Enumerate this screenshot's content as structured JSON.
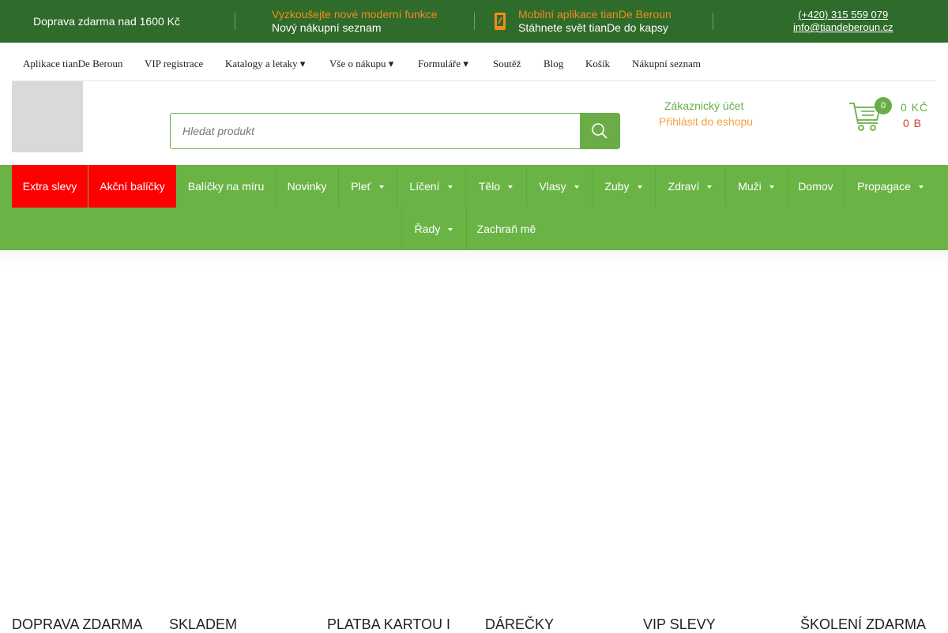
{
  "topbar": {
    "shipping": {
      "icon": "truck-icon",
      "text": "Doprava zdarma nad 1600 Kč"
    },
    "features": {
      "icon": "star-icon",
      "title": "Vyzkoušejte nové moderní funkce",
      "subtitle": "Nový nákupní seznam"
    },
    "app": {
      "icon": "mobile-phone-icon",
      "title": "Mobilní aplikace tianDe Beroun",
      "subtitle": "Stáhnete svět tianDe do kapsy"
    },
    "contact": {
      "icon": "envelope-icon",
      "phone": "(+420) 315 559 079",
      "email": "info@tiandeberoun.cz"
    },
    "colors": {
      "background": "#2f6b2a",
      "accent": "#f28c1e"
    }
  },
  "subnav": {
    "items": [
      "Aplikace tianDe Beroun",
      "VIP registrace",
      "Katalogy a letaky ▾",
      "Vše o nákupu ▾",
      "Formuláře ▾",
      "Soutěž",
      "Blog",
      "Košík",
      "Nákupní seznam"
    ]
  },
  "header": {
    "search": {
      "placeholder": "Hledat produkt",
      "icon": "search-icon"
    },
    "account": {
      "title": "Zákaznický účet",
      "login_icon": "user-icon",
      "login": "Přihlásit do eshopu"
    },
    "cart": {
      "icon": "cart-icon",
      "count": "0",
      "price": "0 KČ",
      "points": "0 B"
    },
    "colors": {
      "primary": "#6aad47",
      "login": "#f2a03c",
      "points": "#d23b2b"
    }
  },
  "mainmenu": {
    "items": [
      "Extra slevy",
      "Akční balíčky",
      "Balíčky na míru",
      "Novinky",
      "Pleť",
      "Líčení",
      "Tělo",
      "Vlasy",
      "Zuby",
      "Zdraví",
      "Muži",
      "Domov",
      "Propagace",
      "Řady",
      "Zachraň mě"
    ],
    "colors": {
      "background": "#6ab445",
      "highlight": "#ff0000"
    }
  },
  "features": [
    {
      "icon": "truck-icon",
      "label": "DOPRAVA ZDARMA"
    },
    {
      "icon": "box-icon",
      "label": "SKLADEM"
    },
    {
      "icon": "credit-card-icon",
      "label": "PLATBA KARTOU I"
    },
    {
      "icon": "gift-icon",
      "label": "DÁREČKY"
    },
    {
      "icon": "percent-icon",
      "label": "VIP SLEVY"
    },
    {
      "icon": "graduation-cap-icon",
      "label": "ŠKOLENÍ ZDARMA"
    }
  ]
}
